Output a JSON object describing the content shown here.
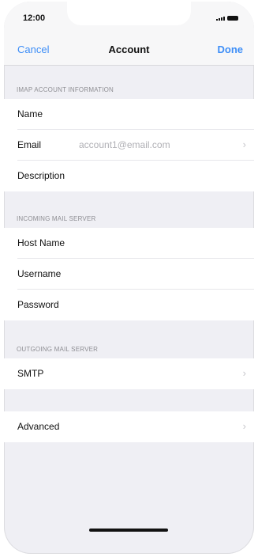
{
  "status_bar": {
    "time": "12:00"
  },
  "nav": {
    "cancel_label": "Cancel",
    "title": "Account",
    "done_label": "Done"
  },
  "sections": {
    "imap_header": "IMAP ACCOUNT INFORMATION",
    "incoming_header": "INCOMING MAIL SERVER",
    "outgoing_header": "OUTGOING MAIL SERVER"
  },
  "imap_rows": {
    "name_label": "Name",
    "email_label": "Email",
    "email_value": "account1@email.com",
    "description_label": "Description"
  },
  "incoming_rows": {
    "host_label": "Host Name",
    "username_label": "Username",
    "password_label": "Password"
  },
  "outgoing_rows": {
    "smtp_label": "SMTP"
  },
  "advanced": {
    "label": "Advanced"
  },
  "icons": {
    "chevron": "›"
  },
  "colors": {
    "accent": "#3d8ef7",
    "background": "#efeff4"
  }
}
